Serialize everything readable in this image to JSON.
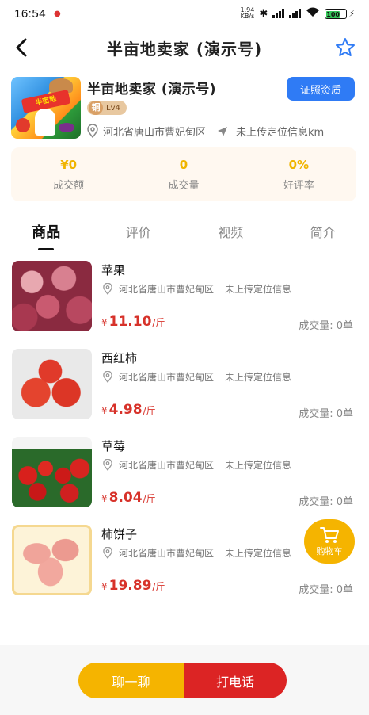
{
  "status_bar": {
    "time": "16:54",
    "net_speed_value": "1.94",
    "net_speed_unit": "KB/s",
    "battery": "100"
  },
  "nav": {
    "title": "半亩地卖家 (演示号)"
  },
  "shop": {
    "name": "半亩地卖家 (演示号)",
    "badge_icon_text": "铜",
    "level": "Lv4",
    "cert_button": "证照资质",
    "address": "河北省唐山市曹妃甸区",
    "location_status": "未上传定位信息km",
    "logo_text": "半亩地"
  },
  "stats": [
    {
      "value": "¥0",
      "label": "成交额"
    },
    {
      "value": "0",
      "label": "成交量"
    },
    {
      "value": "0%",
      "label": "好评率"
    }
  ],
  "tabs": [
    {
      "label": "商品",
      "active": true
    },
    {
      "label": "评价",
      "active": false
    },
    {
      "label": "视频",
      "active": false
    },
    {
      "label": "简介",
      "active": false
    }
  ],
  "products": [
    {
      "name": "苹果",
      "address": "河北省唐山市曹妃甸区",
      "location_status": "未上传定位信息",
      "price_symbol": "¥",
      "price": "11.10",
      "unit": "/斤",
      "sales": "成交量: 0单"
    },
    {
      "name": "西红柿",
      "address": "河北省唐山市曹妃甸区",
      "location_status": "未上传定位信息",
      "price_symbol": "¥",
      "price": "4.98",
      "unit": "/斤",
      "sales": "成交量: 0单"
    },
    {
      "name": "草莓",
      "address": "河北省唐山市曹妃甸区",
      "location_status": "未上传定位信息",
      "price_symbol": "¥",
      "price": "8.04",
      "unit": "/斤",
      "sales": "成交量: 0单"
    },
    {
      "name": "柿饼子",
      "address": "河北省唐山市曹妃甸区",
      "location_status": "未上传定位信息",
      "price_symbol": "¥",
      "price": "19.89",
      "unit": "/斤",
      "sales": "成交量: 0单"
    }
  ],
  "cart": {
    "label": "购物车"
  },
  "bottom": {
    "chat_label": "聊一聊",
    "call_label": "打电话"
  },
  "colors": {
    "accent_yellow": "#f5b400",
    "accent_red": "#dc2424",
    "cert_blue": "#2f7bf5",
    "price_red": "#d7322a"
  }
}
